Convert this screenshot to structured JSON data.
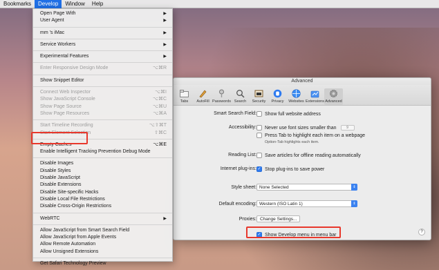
{
  "menubar": {
    "items": [
      "Bookmarks",
      "Develop",
      "Window",
      "Help"
    ]
  },
  "develop_menu": {
    "group1": [
      {
        "label": "Open Page With",
        "submenu": true
      },
      {
        "label": "User Agent",
        "submenu": true
      }
    ],
    "device": {
      "label": "mm     's iMac",
      "submenu": true
    },
    "service_workers": {
      "label": "Service Workers",
      "submenu": true
    },
    "experimental": {
      "label": "Experimental Features",
      "submenu": true
    },
    "responsive": {
      "label": "Enter Responsive Design Mode",
      "shortcut": "⌥⌘R"
    },
    "snippet": {
      "label": "Show Snippet Editor"
    },
    "inspector_group": [
      {
        "label": "Connect Web Inspector",
        "shortcut": "⌥⌘I"
      },
      {
        "label": "Show JavaScript Console",
        "shortcut": "⌥⌘C"
      },
      {
        "label": "Show Page Source",
        "shortcut": "⌥⌘U"
      },
      {
        "label": "Show Page Resources",
        "shortcut": "⌥⌘A"
      }
    ],
    "timeline_group": [
      {
        "label": "Start Timeline Recording",
        "shortcut": "⌥⇧⌘T"
      },
      {
        "label": "Start Element Selection",
        "shortcut": "⇧⌘C"
      }
    ],
    "empty_caches": {
      "label": "Empty Caches",
      "shortcut": "⌥⌘E"
    },
    "itp_debug": {
      "label": "Enable Intelligent Tracking Prevention Debug Mode"
    },
    "disable_group": [
      {
        "label": "Disable Images"
      },
      {
        "label": "Disable Styles"
      },
      {
        "label": "Disable JavaScript"
      },
      {
        "label": "Disable Extensions"
      },
      {
        "label": "Disable Site-specific Hacks"
      },
      {
        "label": "Disable Local File Restrictions"
      },
      {
        "label": "Disable Cross-Origin Restrictions"
      }
    ],
    "webrtc": {
      "label": "WebRTC",
      "submenu": true
    },
    "allow_group": [
      {
        "label": "Allow JavaScript from Smart Search Field"
      },
      {
        "label": "Allow JavaScript from Apple Events"
      },
      {
        "label": "Allow Remote Automation"
      },
      {
        "label": "Allow Unsigned Extensions"
      }
    ],
    "tech_preview": {
      "label": "Get Safari Technology Preview"
    }
  },
  "prefs": {
    "title": "Advanced",
    "toolbar": [
      {
        "label": "Tabs",
        "icon": "tabs-icon"
      },
      {
        "label": "AutoFill",
        "icon": "pencil-icon"
      },
      {
        "label": "Passwords",
        "icon": "key-icon"
      },
      {
        "label": "Search",
        "icon": "search-icon"
      },
      {
        "label": "Security",
        "icon": "security-icon"
      },
      {
        "label": "Privacy",
        "icon": "hand-icon"
      },
      {
        "label": "Websites",
        "icon": "globe-icon"
      },
      {
        "label": "Extensions",
        "icon": "puzzle-icon"
      },
      {
        "label": "Advanced",
        "icon": "gear-icon"
      }
    ],
    "smart_search": {
      "label": "Smart Search Field:",
      "option": "Show full website address",
      "checked": false
    },
    "accessibility": {
      "label": "Accessibility:",
      "option1": "Never use font sizes smaller than",
      "font_size": "9",
      "option2": "Press Tab to highlight each item on a webpage",
      "note": "Option-Tab highlights each item."
    },
    "reading_list": {
      "label": "Reading List:",
      "option": "Save articles for offline reading automatically"
    },
    "plugins": {
      "label": "Internet plug-ins:",
      "option": "Stop plug-ins to save power",
      "checked": true
    },
    "stylesheet": {
      "label": "Style sheet:",
      "value": "None Selected"
    },
    "encoding": {
      "label": "Default encoding:",
      "value": "Western (ISO Latin 1)"
    },
    "proxies": {
      "label": "Proxies:",
      "button": "Change Settings..."
    },
    "develop_menu": {
      "label": "Show Develop menu in menu bar",
      "checked": true
    },
    "help": "?"
  },
  "colors": {
    "accent": "#1f6fe6",
    "highlight_box": "#e8372b"
  }
}
